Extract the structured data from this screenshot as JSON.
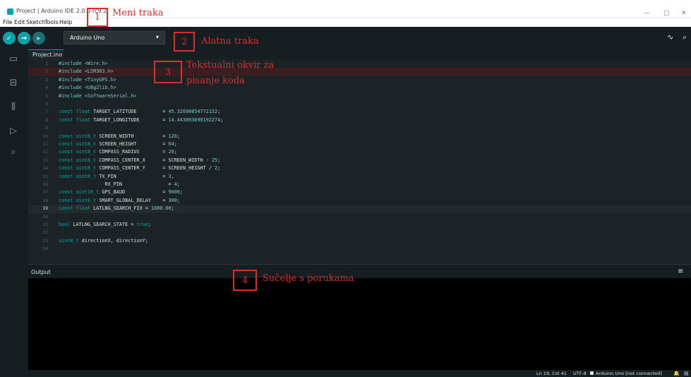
{
  "window": {
    "title": "Project | Arduino IDE 2.0.0-rc9.2",
    "minimize": "—",
    "maximize": "▢",
    "close": "✕"
  },
  "menu": [
    "File",
    "Edit",
    "Sketch",
    "Tools",
    "Help"
  ],
  "toolbar": {
    "verify_icon": "✓",
    "upload_icon": "→",
    "debug_icon": "▸",
    "board": "Arduino Uno",
    "caret": "▾",
    "serial_plotter_icon": "∿",
    "serial_monitor_icon": "⌕"
  },
  "activity": {
    "folder_icon": "▭",
    "board_icon": "⊟",
    "library_icon": "⫼",
    "debug_icon": "▷",
    "search_icon": "⌕"
  },
  "tab": {
    "name": "Project.ino"
  },
  "editor": {
    "active_line": 19,
    "lines": [
      {
        "n": "1",
        "parts": [
          [
            "pp",
            "#include "
          ],
          [
            "inc",
            "<Wire.h>"
          ]
        ]
      },
      {
        "n": "2",
        "parts": [
          [
            "pp",
            "#include "
          ],
          [
            "inc",
            "<LSM303.h>"
          ]
        ]
      },
      {
        "n": "3",
        "parts": [
          [
            "pp",
            "#include "
          ],
          [
            "inc",
            "<TinyGPS.h>"
          ]
        ]
      },
      {
        "n": "4",
        "parts": [
          [
            "pp",
            "#include "
          ],
          [
            "inc",
            "<U8g2lib.h>"
          ]
        ]
      },
      {
        "n": "5",
        "parts": [
          [
            "pp",
            "#include "
          ],
          [
            "inc",
            "<SoftwareSerial.h>"
          ]
        ]
      },
      {
        "n": "6",
        "parts": []
      },
      {
        "n": "7",
        "parts": [
          [
            "kw",
            "const "
          ],
          [
            "kw",
            "float "
          ],
          [
            "id",
            "TARGET_LATITUDE         "
          ],
          [
            "op",
            "= "
          ],
          [
            "num",
            "45.32698854772152"
          ],
          [
            "op",
            ";"
          ]
        ]
      },
      {
        "n": "8",
        "parts": [
          [
            "kw",
            "const "
          ],
          [
            "kw",
            "float "
          ],
          [
            "id",
            "TARGET_LONGITUDE        "
          ],
          [
            "op",
            "= "
          ],
          [
            "num",
            "14.443893690192274"
          ],
          [
            "op",
            ";"
          ]
        ]
      },
      {
        "n": "9",
        "parts": []
      },
      {
        "n": "10",
        "parts": [
          [
            "kw",
            "const "
          ],
          [
            "ty",
            "uint8_t "
          ],
          [
            "id",
            "SCREEN_WIDTH          "
          ],
          [
            "op",
            "= "
          ],
          [
            "num",
            "128"
          ],
          [
            "op",
            ";"
          ]
        ]
      },
      {
        "n": "11",
        "parts": [
          [
            "kw",
            "const "
          ],
          [
            "ty",
            "uint8_t "
          ],
          [
            "id",
            "SCREEN_HEIGHT         "
          ],
          [
            "op",
            "= "
          ],
          [
            "num",
            "64"
          ],
          [
            "op",
            ";"
          ]
        ]
      },
      {
        "n": "12",
        "parts": [
          [
            "kw",
            "const "
          ],
          [
            "ty",
            "uint8_t "
          ],
          [
            "id",
            "COMPASS_RADIUS        "
          ],
          [
            "op",
            "= "
          ],
          [
            "num",
            "20"
          ],
          [
            "op",
            ";"
          ]
        ]
      },
      {
        "n": "13",
        "parts": [
          [
            "kw",
            "const "
          ],
          [
            "ty",
            "uint8_t "
          ],
          [
            "id",
            "COMPASS_CENTER_X      "
          ],
          [
            "op",
            "= SCREEN_WIDTH - "
          ],
          [
            "num",
            "25"
          ],
          [
            "op",
            ";"
          ]
        ]
      },
      {
        "n": "14",
        "parts": [
          [
            "kw",
            "const "
          ],
          [
            "ty",
            "uint8_t "
          ],
          [
            "id",
            "COMPASS_CENTER_Y      "
          ],
          [
            "op",
            "= SCREEN_HEIGHT / "
          ],
          [
            "num",
            "2"
          ],
          [
            "op",
            ";"
          ]
        ]
      },
      {
        "n": "15",
        "parts": [
          [
            "kw",
            "const "
          ],
          [
            "ty",
            "uint8_t "
          ],
          [
            "id",
            "TX_PIN                "
          ],
          [
            "op",
            "= "
          ],
          [
            "num",
            "3"
          ],
          [
            "op",
            ","
          ]
        ]
      },
      {
        "n": "16",
        "parts": [
          [
            "id",
            "                RX_PIN                "
          ],
          [
            "op",
            "= "
          ],
          [
            "num",
            "4"
          ],
          [
            "op",
            ";"
          ]
        ]
      },
      {
        "n": "17",
        "parts": [
          [
            "kw",
            "const "
          ],
          [
            "ty",
            "uint16_t "
          ],
          [
            "id",
            "GPS_BAUD             "
          ],
          [
            "op",
            "= "
          ],
          [
            "num",
            "9600"
          ],
          [
            "op",
            ";"
          ]
        ]
      },
      {
        "n": "18",
        "parts": [
          [
            "kw",
            "const "
          ],
          [
            "ty",
            "uint8_t "
          ],
          [
            "id",
            "SMART_GLOBAL_DELAY    "
          ],
          [
            "op",
            "= "
          ],
          [
            "num",
            "300"
          ],
          [
            "op",
            ";"
          ]
        ]
      },
      {
        "n": "19",
        "parts": [
          [
            "kw",
            "const "
          ],
          [
            "kw",
            "float "
          ],
          [
            "id",
            "LATLNG_SEARCH_FIX "
          ],
          [
            "op",
            "= "
          ],
          [
            "num",
            "1000.00"
          ],
          [
            "op",
            ";"
          ]
        ]
      },
      {
        "n": "20",
        "parts": []
      },
      {
        "n": "21",
        "parts": [
          [
            "kw",
            "bool "
          ],
          [
            "id",
            "LATLNG_SEARCH_STATE "
          ],
          [
            "op",
            "= "
          ],
          [
            "kw",
            "true"
          ],
          [
            "op",
            ";"
          ]
        ]
      },
      {
        "n": "22",
        "parts": []
      },
      {
        "n": "23",
        "parts": [
          [
            "ty",
            "uint8_t "
          ],
          [
            "id",
            "directionX, directionY;"
          ]
        ]
      },
      {
        "n": "24",
        "parts": []
      }
    ]
  },
  "output": {
    "title": "Output",
    "menu_icon": "≡"
  },
  "status": {
    "position": "Ln 19, Col 41",
    "encoding": "UTF-8",
    "board": "Arduino Uno [not connected]",
    "bell_icon": "🔔",
    "panel_icon": "▤"
  },
  "annotations": [
    {
      "num": "1",
      "label": "Meni traka"
    },
    {
      "num": "2",
      "label": "Alatna traka"
    },
    {
      "num": "3",
      "label": "Tekstualni okvir za"
    },
    {
      "num": "3b",
      "label": "pisanje koda"
    },
    {
      "num": "4",
      "label": "Sučelje s porukama"
    }
  ],
  "colors": {
    "accent": "#0ca1a6",
    "annotation": "#e02b2b"
  }
}
